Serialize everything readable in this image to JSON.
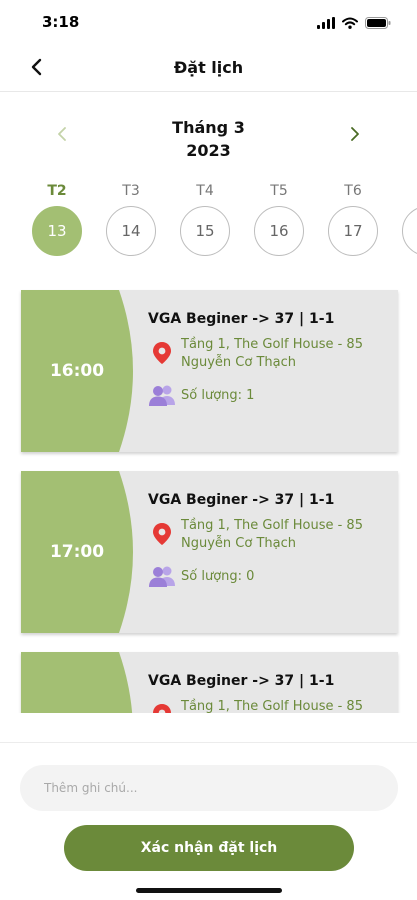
{
  "status_bar": {
    "time": "3:18",
    "icons": [
      "signal-icon",
      "wifi-icon",
      "battery-icon"
    ]
  },
  "header": {
    "title": "Đặt lịch",
    "back_icon": "chevron-left-icon"
  },
  "calendar": {
    "month": "Tháng 3",
    "year": "2023",
    "prev_icon": "chevron-left-icon",
    "next_icon": "chevron-right-icon",
    "days": [
      {
        "dow": "T2",
        "num": "13",
        "active": true
      },
      {
        "dow": "T3",
        "num": "14",
        "active": false
      },
      {
        "dow": "T4",
        "num": "15",
        "active": false
      },
      {
        "dow": "T5",
        "num": "16",
        "active": false
      },
      {
        "dow": "T6",
        "num": "17",
        "active": false
      },
      {
        "dow": "",
        "num": "",
        "active": false
      }
    ]
  },
  "slots": [
    {
      "time": "16:00",
      "title": "VGA Beginer -> 37 | 1-1",
      "location": "Tầng 1, The Golf House - 85 Nguyễn Cơ Thạch",
      "quantity": "Số lượng: 1"
    },
    {
      "time": "17:00",
      "title": "VGA Beginer -> 37 | 1-1",
      "location": "Tầng 1, The Golf House - 85 Nguyễn Cơ Thạch",
      "quantity": "Số lượng: 0"
    },
    {
      "time": "",
      "title": "VGA Beginer -> 37 | 1-1",
      "location": "Tầng 1, The Golf House - 85",
      "quantity": ""
    }
  ],
  "note": {
    "placeholder": "Thêm ghi chú...",
    "value": ""
  },
  "confirm": {
    "label": "Xác nhận đặt lịch"
  },
  "colors": {
    "accent_dark": "#6b8a3a",
    "accent_light": "#a3bf73",
    "card_bg": "#e7e7e7",
    "pin": "#e53935",
    "people": "#9b7fd8"
  }
}
